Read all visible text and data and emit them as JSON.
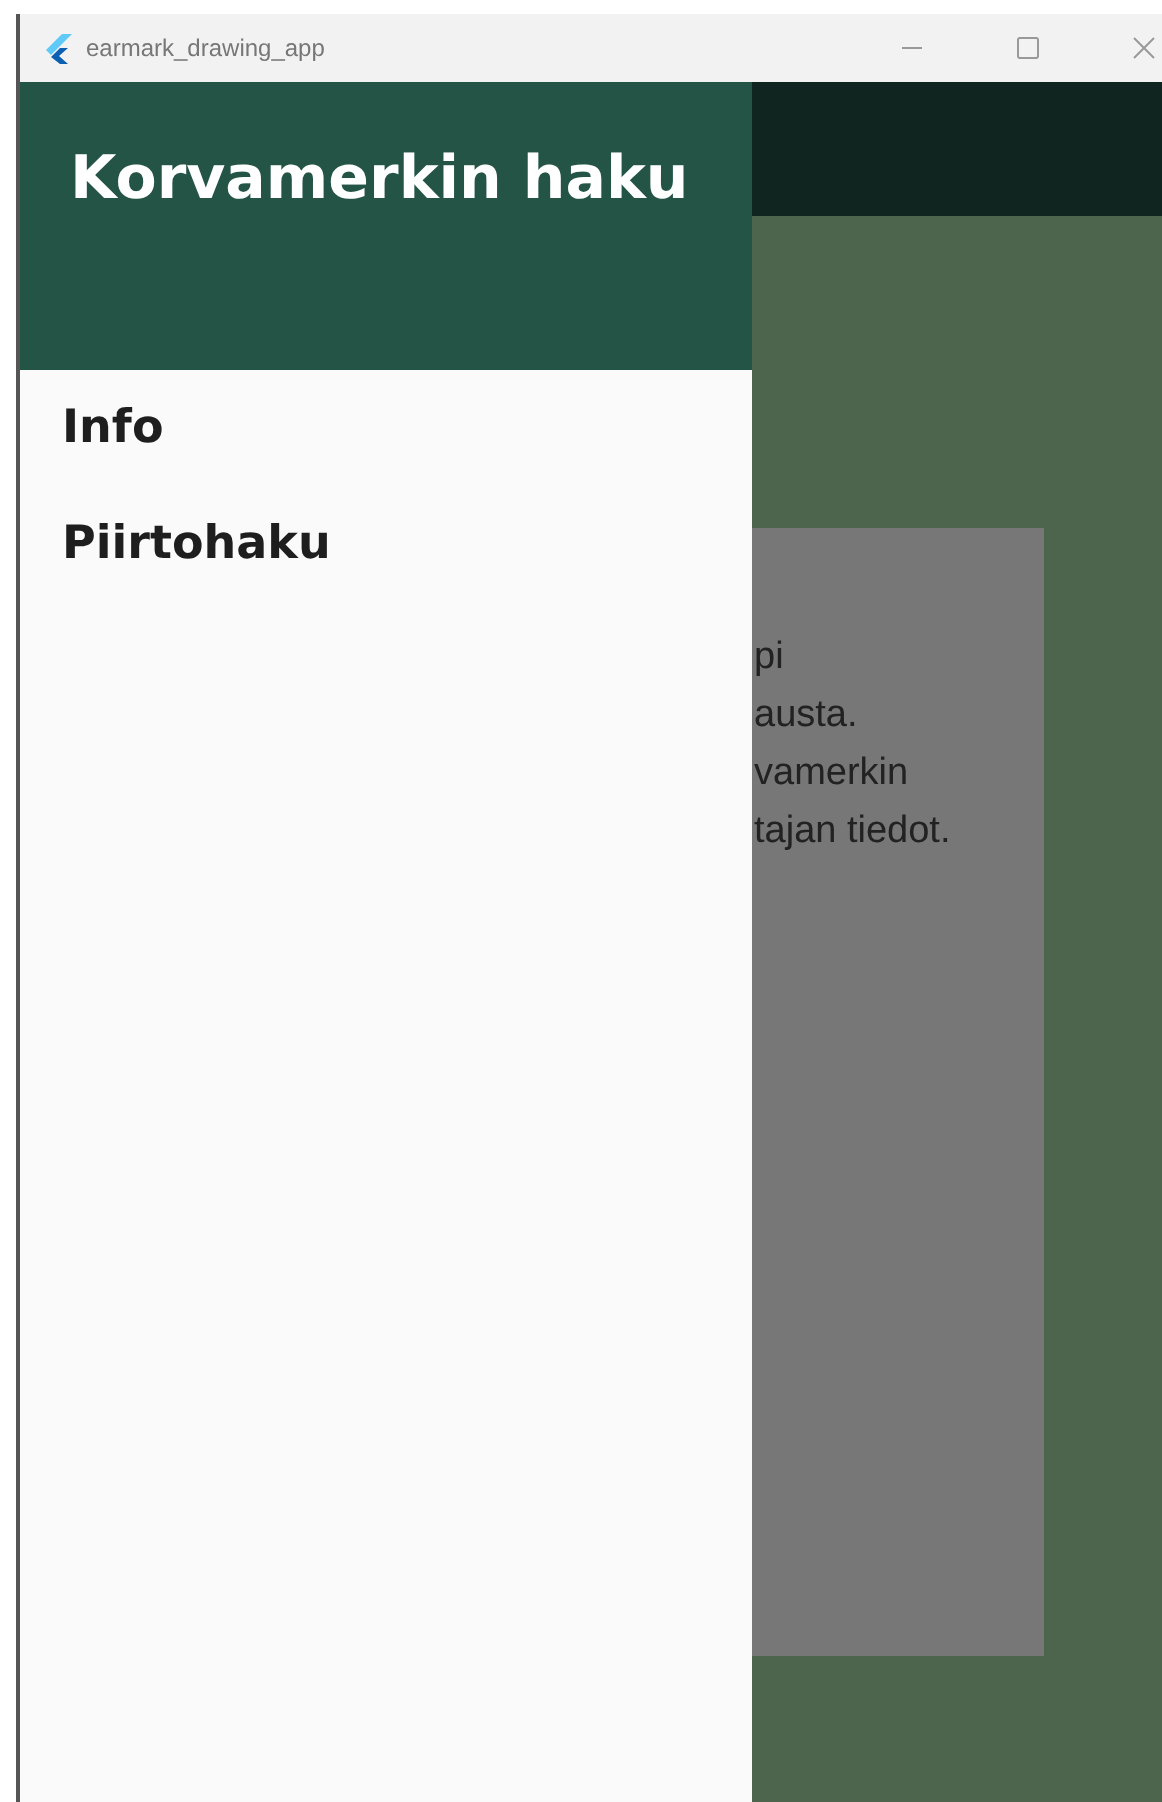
{
  "window": {
    "title": "earmark_drawing_app"
  },
  "drawer": {
    "title": "Korvamerkin haku",
    "items": [
      {
        "label": "Info"
      },
      {
        "label": "Piirtohaku"
      }
    ]
  },
  "card": {
    "lines": [
      "pi",
      "austa.",
      "vamerkin",
      "tajan tiedot."
    ]
  }
}
